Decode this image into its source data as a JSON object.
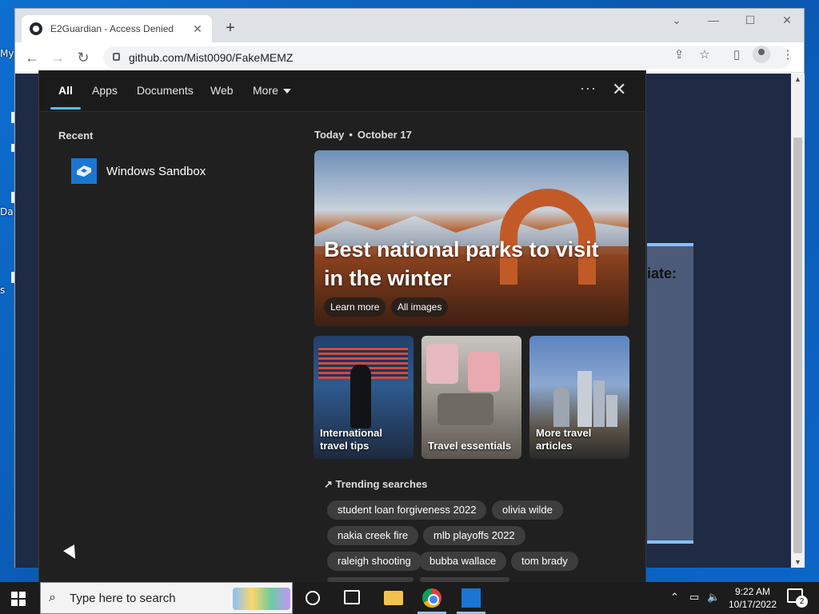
{
  "desktop": {
    "labels": [
      "My",
      "Da",
      "s"
    ]
  },
  "browser": {
    "tab_title": "E2Guardian - Access Denied",
    "url": "github.com/Mist0090/FakeMEMZ",
    "page_partial_text": "iate:"
  },
  "search_flyout": {
    "tabs": [
      {
        "label": "All",
        "active": true
      },
      {
        "label": "Apps"
      },
      {
        "label": "Documents"
      },
      {
        "label": "Web"
      },
      {
        "label": "More"
      }
    ],
    "recent_title": "Recent",
    "recent_items": [
      {
        "label": "Windows Sandbox",
        "icon": "windows-sandbox-icon"
      }
    ],
    "today_label": "Today",
    "date_label": "October 17",
    "hero": {
      "title": "Best national parks to visit in the winter",
      "buttons": [
        "Learn more",
        "All images"
      ]
    },
    "cards": [
      {
        "caption_line1": "International",
        "caption_line2": "travel tips"
      },
      {
        "caption_line1": "",
        "caption_line2": "Travel essentials"
      },
      {
        "caption_line1": "More travel",
        "caption_line2": "articles"
      }
    ],
    "trending_title": "Trending searches",
    "trending": [
      [
        "student loan forgiveness 2022",
        "olivia wilde"
      ],
      [
        "nakia creek fire",
        "mlb playoffs 2022"
      ],
      [
        "raleigh shooting",
        "bubba wallace",
        "tom brady"
      ]
    ]
  },
  "taskbar": {
    "search_placeholder": "Type here to search",
    "clock_time": "9:22 AM",
    "clock_date": "10/17/2022",
    "notification_count": "2"
  },
  "colors": {
    "accent": "#4cc2ff",
    "flyout_bg": "#202020",
    "taskbar_bg": "#1c1c1c"
  }
}
